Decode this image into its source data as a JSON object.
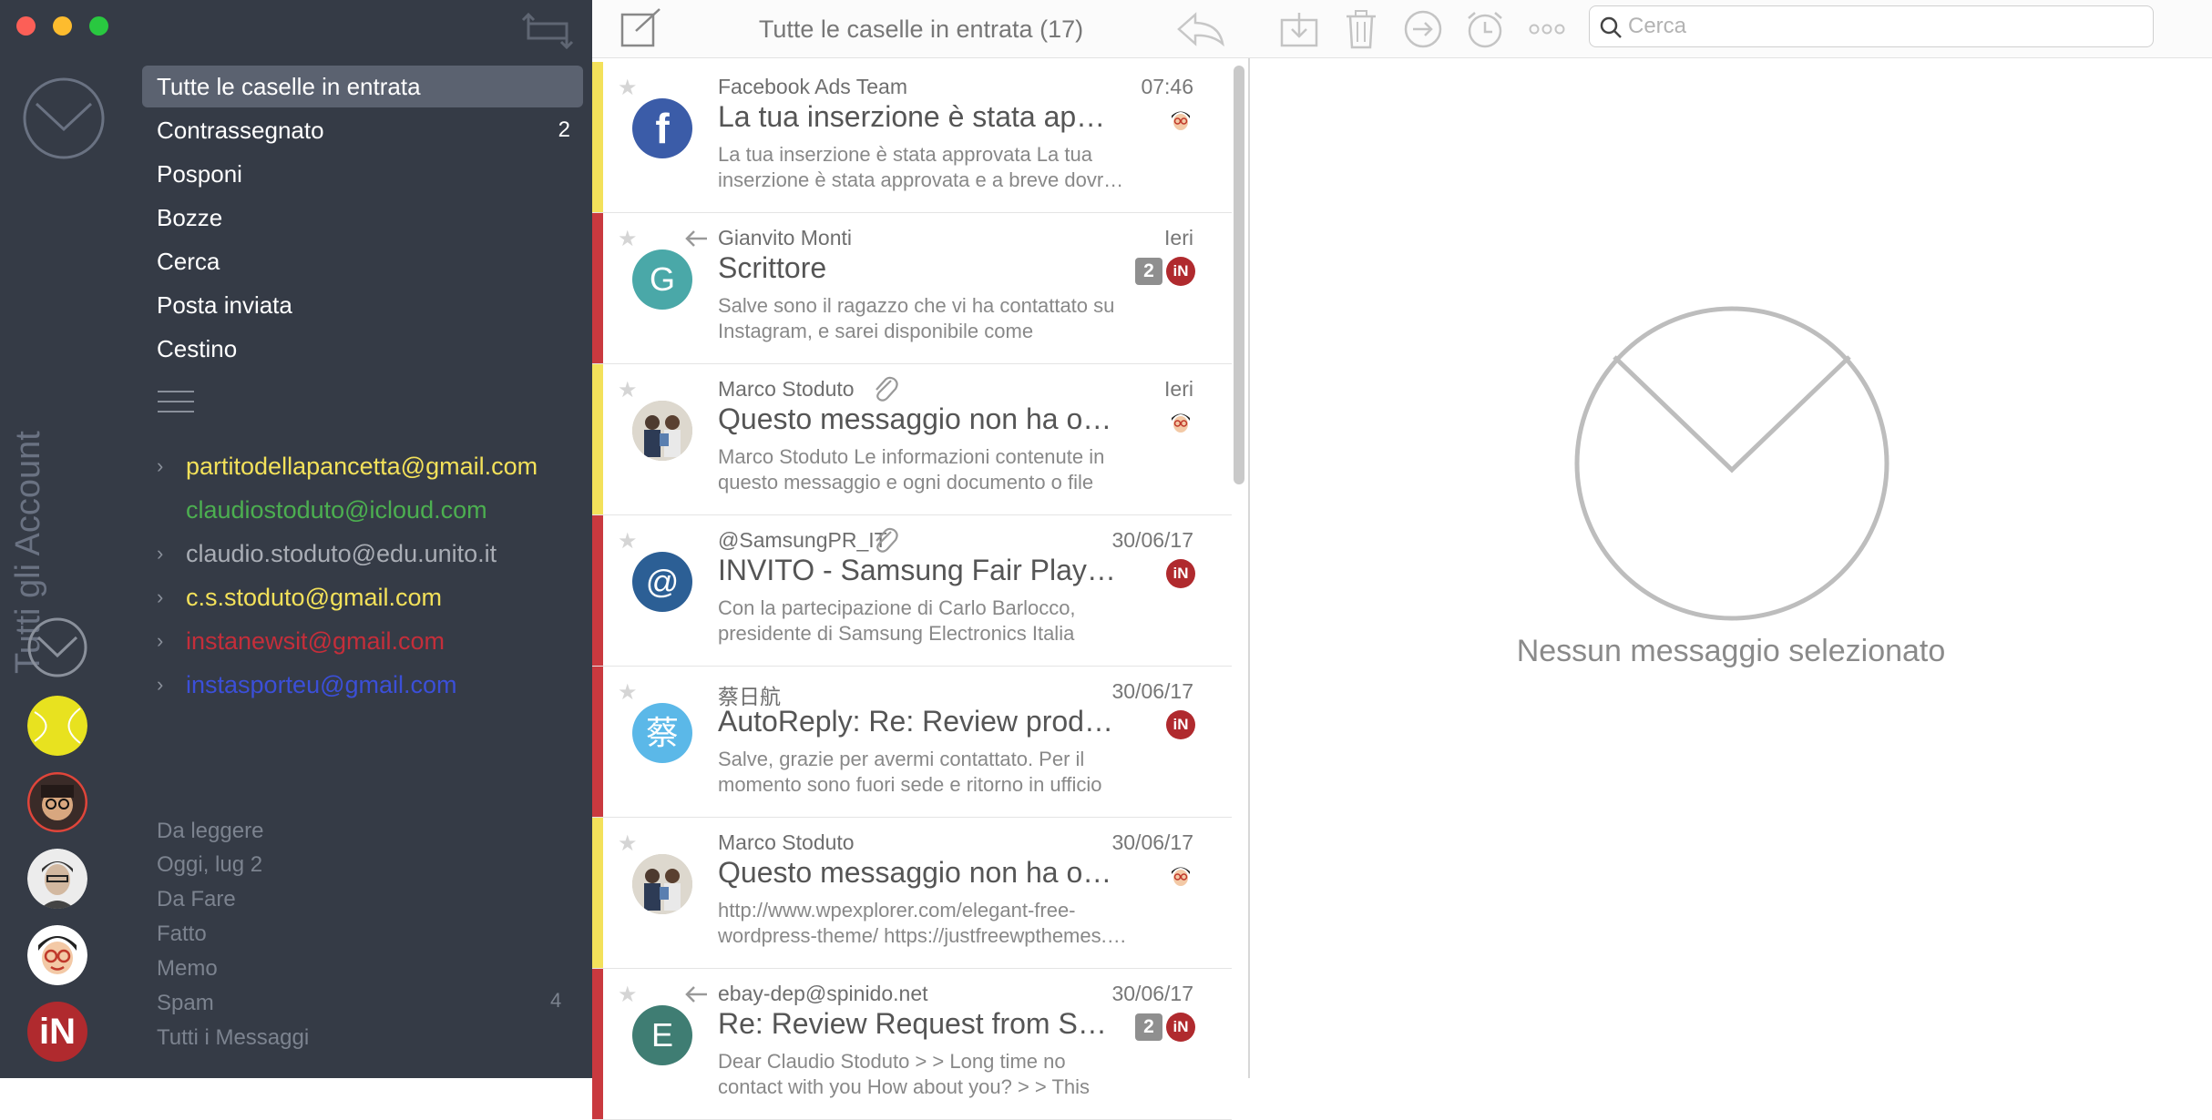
{
  "colors": {
    "sidebar_bg": "#353b46",
    "selected_bg": "#5b6270",
    "flag_yellow": "#f3e15a",
    "flag_red": "#c9393f",
    "in_red": "#b02a2e"
  },
  "rail": {
    "label": "Tutti gli Account",
    "icons": [
      "mail-icon",
      "tennis-ball-avatar",
      "avatar-glasses",
      "avatar-portrait",
      "avatar-cartoon",
      "instanews-logo"
    ],
    "logo_text": "iN"
  },
  "sidebar": {
    "folders": [
      {
        "label": "Tutte le caselle in entrata",
        "count": "",
        "selected": true
      },
      {
        "label": "Contrassegnato",
        "count": "2"
      },
      {
        "label": "Posponi",
        "count": ""
      },
      {
        "label": "Bozze",
        "count": ""
      },
      {
        "label": "Cerca",
        "count": ""
      },
      {
        "label": "Posta inviata",
        "count": ""
      },
      {
        "label": "Cestino",
        "count": ""
      }
    ],
    "accounts": [
      {
        "email": "partitodellapancetta@gmail.com",
        "color": "#f3e15a",
        "expandable": true
      },
      {
        "email": "claudiostoduto@icloud.com",
        "color": "#4caf50",
        "expandable": false
      },
      {
        "email": "claudio.stoduto@edu.unito.it",
        "color": "#a9adb5",
        "expandable": true
      },
      {
        "email": "c.s.stoduto@gmail.com",
        "color": "#f3e15a",
        "expandable": true
      },
      {
        "email": "instanewsit@gmail.com",
        "color": "#c42e3a",
        "expandable": true
      },
      {
        "email": "instasporteu@gmail.com",
        "color": "#3b4fd8",
        "expandable": true
      }
    ],
    "smart_folders": [
      "Da leggere",
      "Oggi, lug 2",
      "Da Fare",
      "Fatto",
      "Memo",
      "Spam",
      "Tutti i Messaggi"
    ],
    "spam_count": "4"
  },
  "list": {
    "title": "Tutte le caselle in entrata (17)",
    "messages": [
      {
        "from": "Facebook Ads Team",
        "date": "07:46",
        "subject": "La tua inserzione è stata appr…",
        "preview": "La tua inserzione è stata approvata La tua inserzione è stata approvata e a breve dovr…",
        "flag": "yellow",
        "avatar_letter": "f",
        "avatar_color": "#3b5ca8",
        "count": "",
        "badge": "face",
        "replied": false,
        "attachment": false
      },
      {
        "from": "Gianvito Monti",
        "date": "Ieri",
        "subject": "Scrittore",
        "preview": "Salve sono il ragazzo che vi ha contattato su Instagram, e sarei disponibile come scrittore…",
        "flag": "red",
        "avatar_letter": "G",
        "avatar_color": "#4aa8a8",
        "count": "2",
        "badge": "iN",
        "replied": true,
        "attachment": false
      },
      {
        "from": "Marco Stoduto",
        "date": "Ieri",
        "subject": "Questo messaggio non ha og…",
        "preview": "Marco Stoduto Le informazioni contenute in questo messaggio e ogni documento o file a…",
        "flag": "yellow",
        "avatar_letter": "",
        "avatar_color": "#c8c2b6",
        "count": "",
        "badge": "face",
        "replied": false,
        "attachment": true
      },
      {
        "from": "@SamsungPR_IT",
        "date": "30/06/17",
        "subject": "INVITO - Samsung Fair Play -…",
        "preview": "Con la partecipazione di Carlo Barlocco, presidente di Samsung Electronics Italia Bru…",
        "flag": "red",
        "avatar_letter": "@",
        "avatar_color": "#2c5f95",
        "count": "",
        "badge": "iN",
        "replied": false,
        "attachment": true
      },
      {
        "from": "蔡日航",
        "date": "30/06/17",
        "subject": "AutoReply: Re: Review prodotti",
        "preview": "Salve, grazie per avermi contattato. Per il momento sono fuori sede e ritorno in ufficio i…",
        "flag": "red",
        "avatar_letter": "蔡",
        "avatar_color": "#5bb8e8",
        "count": "",
        "badge": "iN",
        "replied": false,
        "attachment": false
      },
      {
        "from": "Marco Stoduto",
        "date": "30/06/17",
        "subject": "Questo messaggio non ha og…",
        "preview": "http://www.wpexplorer.com/elegant-free-wordpress-theme/ https://justfreewpthemes.…",
        "flag": "yellow",
        "avatar_letter": "",
        "avatar_color": "#c8c2b6",
        "count": "",
        "badge": "face",
        "replied": false,
        "attachment": false
      },
      {
        "from": "ebay-dep@spinido.net",
        "date": "30/06/17",
        "subject": "Re: Review Request from S…",
        "preview": "Dear Claudio Stoduto > > Long time no contact with you How about you? > > This is…",
        "flag": "red",
        "avatar_letter": "E",
        "avatar_color": "#3f7d73",
        "count": "2",
        "badge": "iN",
        "replied": true,
        "attachment": false
      }
    ]
  },
  "viewer": {
    "search_placeholder": "Cerca",
    "empty_message": "Nessun messaggio selezionato",
    "toolbar_icons": [
      "archive-icon",
      "trash-icon",
      "move-icon",
      "snooze-icon",
      "more-icon"
    ]
  }
}
